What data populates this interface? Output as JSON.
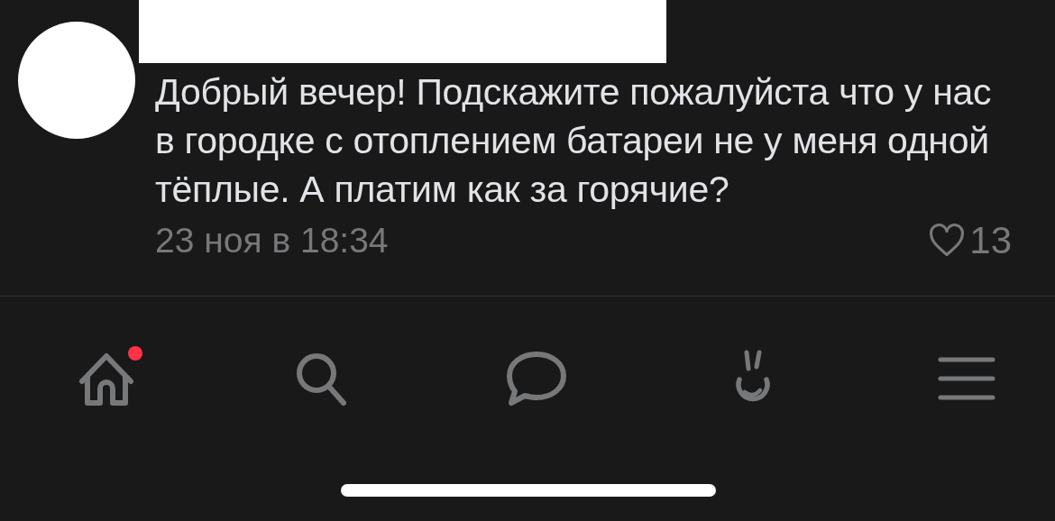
{
  "comment": {
    "text": "Добрый вечер! Подскажите пожалуйста что у нас в городке с отоплением батареи не у меня одной тёплые. А платим как за горячие?",
    "date": "23 ноя в 18:34",
    "likes": "13",
    "liked": false
  },
  "nav": [
    {
      "kind": "home",
      "badge": true
    },
    {
      "kind": "search",
      "badge": false
    },
    {
      "kind": "messages",
      "badge": false
    },
    {
      "kind": "clips",
      "badge": false
    },
    {
      "kind": "menu",
      "badge": false
    }
  ]
}
